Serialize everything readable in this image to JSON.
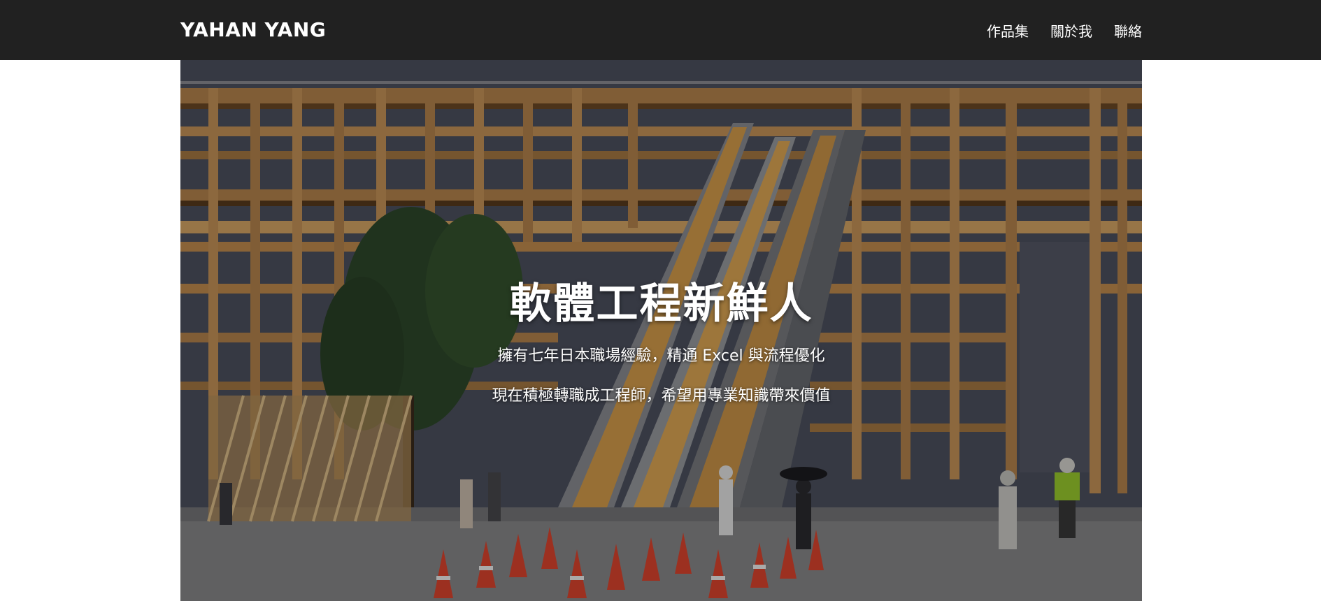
{
  "navbar": {
    "brand": "YAHAN YANG",
    "links": [
      "作品集",
      "關於我",
      "聯絡"
    ]
  },
  "hero": {
    "title": "軟體工程新鮮人",
    "line1": "擁有七年日本職場經驗，精通 Excel 與流程優化",
    "line2": "現在積極轉職成工程師，希望用專業知識帶來價值"
  },
  "colors": {
    "navbar_bg": "#212121",
    "page_bg": "#ffffff",
    "text": "#ffffff",
    "wood": "#c9965a",
    "sky": "#4e5260"
  },
  "icons": [
    "wooden-structure-image",
    "escalator-image",
    "traffic-cone-image",
    "tree-image"
  ]
}
